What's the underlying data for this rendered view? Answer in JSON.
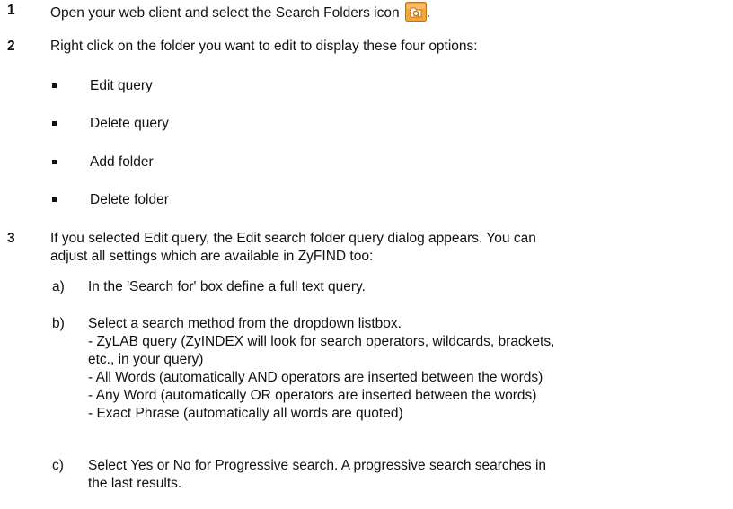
{
  "steps": [
    {
      "number": "1",
      "text": "Open your web client and select the Search Folders icon",
      "trailing": ".",
      "icon": "search-folders-icon"
    },
    {
      "number": "2",
      "text": "Right click on the folder you want to edit to display these four options:",
      "bullets": [
        "Edit query",
        "Delete query",
        "Add folder",
        "Delete folder"
      ]
    },
    {
      "number": "3",
      "lines": [
        "If you selected Edit query, the Edit search folder query dialog appears. You can",
        "adjust all settings which are available in ZyFIND too:"
      ],
      "substeps": [
        {
          "letter": "a)",
          "lines": [
            "In the 'Search for' box define a full text query."
          ]
        },
        {
          "letter": "b)",
          "lines": [
            "Select a search method from the dropdown listbox.",
            "- ZyLAB query (ZyINDEX will look for search operators, wildcards, brackets,",
            "etc., in your query)",
            "- All Words (automatically AND operators are inserted between the words)",
            "- Any Word (automatically OR operators are inserted between the words)",
            "- Exact Phrase (automatically all words are quoted)"
          ]
        },
        {
          "letter": "c)",
          "lines": [
            "Select Yes or No for Progressive search. A progressive search searches in",
            "the last results."
          ]
        }
      ]
    }
  ],
  "colors": {
    "icon_orange": "#f0a030",
    "icon_dark": "#c8700a",
    "text": "#111111"
  }
}
